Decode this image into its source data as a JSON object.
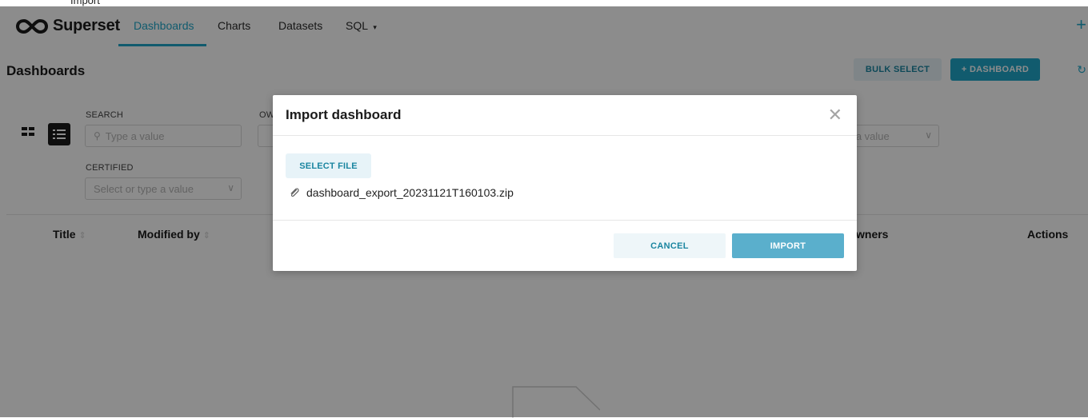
{
  "screenshot_header": "Import",
  "brand": {
    "name": "Superset"
  },
  "nav": {
    "items": [
      {
        "label": "Dashboards",
        "active": true
      },
      {
        "label": "Charts"
      },
      {
        "label": "Datasets"
      },
      {
        "label": "SQL",
        "dropdown": true
      }
    ],
    "plus": "+"
  },
  "subheader": {
    "title": "Dashboards",
    "bulk_select": "BULK SELECT",
    "new_dashboard": "+ DASHBOARD"
  },
  "filters": {
    "search_label": "SEARCH",
    "search_placeholder": "Type a value",
    "owner_label_partial": "OW",
    "certified_label": "CERTIFIED",
    "certified_placeholder": "Select or type a value",
    "right_select_partial": "e a value"
  },
  "table": {
    "columns": [
      {
        "label": "Title",
        "sortable": true
      },
      {
        "label": "Modified by",
        "sortable": true
      },
      {
        "label": "wners",
        "sortable": false
      },
      {
        "label": "Actions",
        "sortable": false
      }
    ]
  },
  "modal": {
    "title": "Import dashboard",
    "select_file": "SELECT FILE",
    "file_name": "dashboard_export_20231121T160103.zip",
    "cancel": "CANCEL",
    "import": "IMPORT"
  },
  "colors": {
    "accent": "#20a7c9",
    "accent_light": "#e7f3f8",
    "import_button": "#5aafcc",
    "overlay": "rgba(0,0,0,0.45)"
  }
}
